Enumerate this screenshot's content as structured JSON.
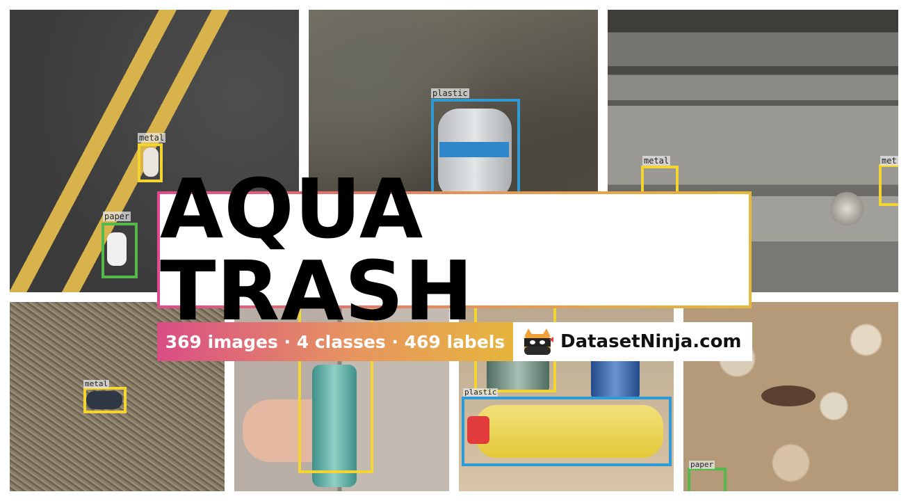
{
  "title": "AQUA TRASH",
  "stats": "369 images · 4 classes · 469 labels",
  "brand": "DatasetNinja.com",
  "labels": {
    "t1_metal": "metal",
    "t1_paper": "paper",
    "t2_plastic": "plastic",
    "t3_metal": "metal",
    "t3_metal_cut": "met",
    "t4_metal": "metal",
    "t6_plastic": "plastic",
    "t7_paper": "paper"
  },
  "colors": {
    "metal": "#f3d430",
    "plastic": "#2f9bd6",
    "paper": "#55b84a",
    "gradient_start": "#e04a8c",
    "gradient_end": "#e7b83a"
  },
  "icons": {
    "brand_logo": "ninja-cat-icon"
  }
}
